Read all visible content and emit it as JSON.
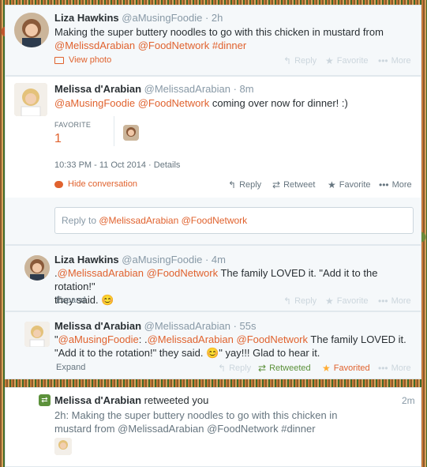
{
  "tweet1": {
    "name": "Liza Hawkins",
    "handle": "@aMusingFoodie",
    "time": "· 2h",
    "text_plain": "Making the super buttery noodles to go with this chicken in mustard from ",
    "mention1": "@MelissdArabian",
    "mention2": "@FoodNetwork",
    "hashtag": "#dinner",
    "view_photo": "View photo",
    "reply": "Reply",
    "favorite": "Favorite",
    "more": "More"
  },
  "tweet2": {
    "name": "Melissa d'Arabian",
    "handle": "@MelissadArabian",
    "time": "· 8m",
    "mention1": "@aMusingFoodie",
    "mention2": "@FoodNetwork",
    "text_plain": " coming over now for dinner!  :)",
    "favorite_label": "FAVORITE",
    "favorite_count": "1",
    "timestamp": "10:33 PM - 11 Oct 2014",
    "details": "· Details",
    "hide_conversation": "Hide conversation",
    "reply": "Reply",
    "retweet": "Retweet",
    "favorite": "Favorite",
    "more": "More"
  },
  "reply_box": {
    "prefix": "Reply to ",
    "mention1": "@MelissadArabian",
    "mention2": "@FoodNetwork"
  },
  "tweet3": {
    "name": "Liza Hawkins",
    "handle": "@aMusingFoodie",
    "time": "· 4m",
    "dot": ".",
    "mention1": "@MelissadArabian",
    "mention2": "@FoodNetwork",
    "text_plain": " The family LOVED it. \"Add it to the rotation!\"",
    "text_line2": "they said. 😊",
    "expand": "Expand",
    "reply": "Reply",
    "favorite": "Favorite",
    "more": "More"
  },
  "tweet4": {
    "name": "Melissa d'Arabian",
    "handle": "@MelissadArabian",
    "time": "· 55s",
    "quote_open": "\"",
    "mention0": "@aMusingFoodie",
    "colon": ": .",
    "mention1": "@MelissadArabian",
    "mention2": "@FoodNetwork",
    "text_plain": " The family LOVED it.",
    "text_line2": "\"Add it to the rotation!\" they said. 😊\" yay!!!  Glad to hear it.",
    "expand": "Expand",
    "reply": "Reply",
    "retweeted": "Retweeted",
    "favorited": "Favorited",
    "more": "More"
  },
  "notification": {
    "name": "Melissa d'Arabian",
    "action": " retweeted you",
    "time": "2m",
    "line1": "2h: Making the super buttery noodles to go with this chicken in",
    "line2": "mustard from @MelissadArabian @FoodNetwork #dinner"
  },
  "colors": {
    "link": "#e0622e",
    "retweet_green": "#5c913b",
    "favorite_orange": "#ffac33",
    "muted": "#8899a6"
  }
}
